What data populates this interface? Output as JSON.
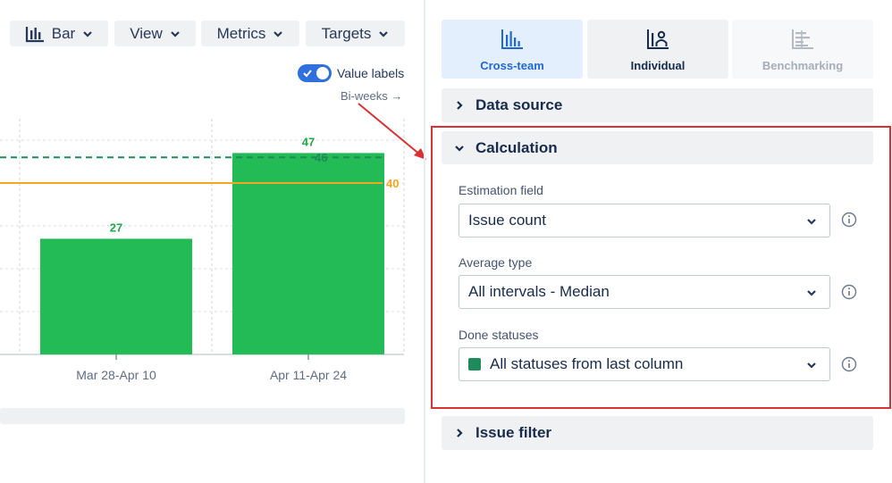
{
  "toolbar": {
    "chart_type_label": "Bar",
    "view_label": "View",
    "metrics_label": "Metrics",
    "targets_label": "Targets"
  },
  "controls": {
    "value_labels": "Value labels",
    "value_labels_on": true,
    "period_link": "Bi-weeks →"
  },
  "chart_data": {
    "type": "bar",
    "categories": [
      "Mar 28-Apr 10",
      "Apr 11-Apr 24"
    ],
    "values": [
      27,
      47
    ],
    "value_labels": [
      "27",
      "47"
    ],
    "reference_lines": [
      {
        "value": 46,
        "label": "46",
        "style": "dashed",
        "color": "#1f8a5b"
      },
      {
        "value": 40,
        "label": "40",
        "style": "solid",
        "color": "#f5a623"
      }
    ],
    "ylim": [
      0,
      55
    ],
    "grid": true,
    "bar_color": "#22bb55"
  },
  "view_tabs": [
    {
      "label": "Cross-team",
      "icon": "bar-chart-icon",
      "active": true
    },
    {
      "label": "Individual",
      "icon": "person-chart-icon",
      "active": false
    },
    {
      "label": "Benchmarking",
      "icon": "benchmark-icon",
      "active": false,
      "disabled": true
    }
  ],
  "sections": {
    "data_source": "Data source",
    "calculation": "Calculation",
    "issue_filter": "Issue filter"
  },
  "calculation": {
    "estimation_field": {
      "label": "Estimation field",
      "value": "Issue count"
    },
    "average_type": {
      "label": "Average type",
      "value": "All intervals - Median"
    },
    "done_statuses": {
      "label": "Done statuses",
      "value": "All statuses from last column",
      "swatch_color": "#1f8a5b"
    }
  },
  "colors": {
    "accent": "#2f6fde",
    "highlight": "#d93131",
    "active_tab_bg": "#e4effd",
    "active_tab_text": "#1f67d2"
  }
}
